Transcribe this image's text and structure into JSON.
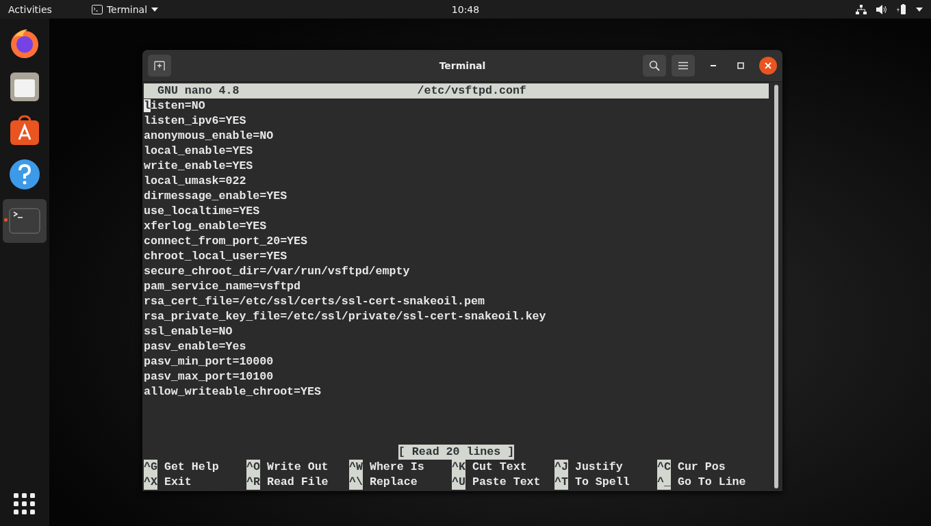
{
  "top_bar": {
    "activities": "Activities",
    "app_menu": "Terminal",
    "clock": "10:48"
  },
  "dock": {
    "items": [
      {
        "kind": "firefox",
        "selected": false,
        "running": false
      },
      {
        "kind": "files",
        "selected": false,
        "running": false
      },
      {
        "kind": "software",
        "selected": false,
        "running": false
      },
      {
        "kind": "help",
        "selected": false,
        "running": false
      },
      {
        "kind": "terminal",
        "selected": true,
        "running": true
      }
    ]
  },
  "window": {
    "title": "Terminal"
  },
  "nano": {
    "version": "GNU nano 4.8",
    "filename": "/etc/vsftpd.conf",
    "lines": [
      {
        "text": "listen=NO",
        "cursor": true
      },
      {
        "text": "listen_ipv6=YES",
        "cursor": false
      },
      {
        "text": "anonymous_enable=NO",
        "cursor": false
      },
      {
        "text": "local_enable=YES",
        "cursor": false
      },
      {
        "text": "write_enable=YES",
        "cursor": false
      },
      {
        "text": "local_umask=022",
        "cursor": false
      },
      {
        "text": "dirmessage_enable=YES",
        "cursor": false
      },
      {
        "text": "use_localtime=YES",
        "cursor": false
      },
      {
        "text": "xferlog_enable=YES",
        "cursor": false
      },
      {
        "text": "connect_from_port_20=YES",
        "cursor": false
      },
      {
        "text": "chroot_local_user=YES",
        "cursor": false
      },
      {
        "text": "secure_chroot_dir=/var/run/vsftpd/empty",
        "cursor": false
      },
      {
        "text": "pam_service_name=vsftpd",
        "cursor": false
      },
      {
        "text": "rsa_cert_file=/etc/ssl/certs/ssl-cert-snakeoil.pem",
        "cursor": false
      },
      {
        "text": "rsa_private_key_file=/etc/ssl/private/ssl-cert-snakeoil.key",
        "cursor": false
      },
      {
        "text": "ssl_enable=NO",
        "cursor": false
      },
      {
        "text": "pasv_enable=Yes",
        "cursor": false
      },
      {
        "text": "pasv_min_port=10000",
        "cursor": false
      },
      {
        "text": "pasv_max_port=10100",
        "cursor": false
      },
      {
        "text": "allow_writeable_chroot=YES",
        "cursor": false
      }
    ],
    "status": "[ Read 20 lines ]",
    "shortcuts": [
      {
        "key": "^G",
        "label": "Get Help"
      },
      {
        "key": "^O",
        "label": "Write Out"
      },
      {
        "key": "^W",
        "label": "Where Is"
      },
      {
        "key": "^K",
        "label": "Cut Text"
      },
      {
        "key": "^J",
        "label": "Justify"
      },
      {
        "key": "^C",
        "label": "Cur Pos"
      },
      {
        "key": "^X",
        "label": "Exit"
      },
      {
        "key": "^R",
        "label": "Read File"
      },
      {
        "key": "^\\",
        "label": "Replace"
      },
      {
        "key": "^U",
        "label": "Paste Text"
      },
      {
        "key": "^T",
        "label": "To Spell"
      },
      {
        "key": "^_",
        "label": "Go To Line"
      }
    ]
  }
}
